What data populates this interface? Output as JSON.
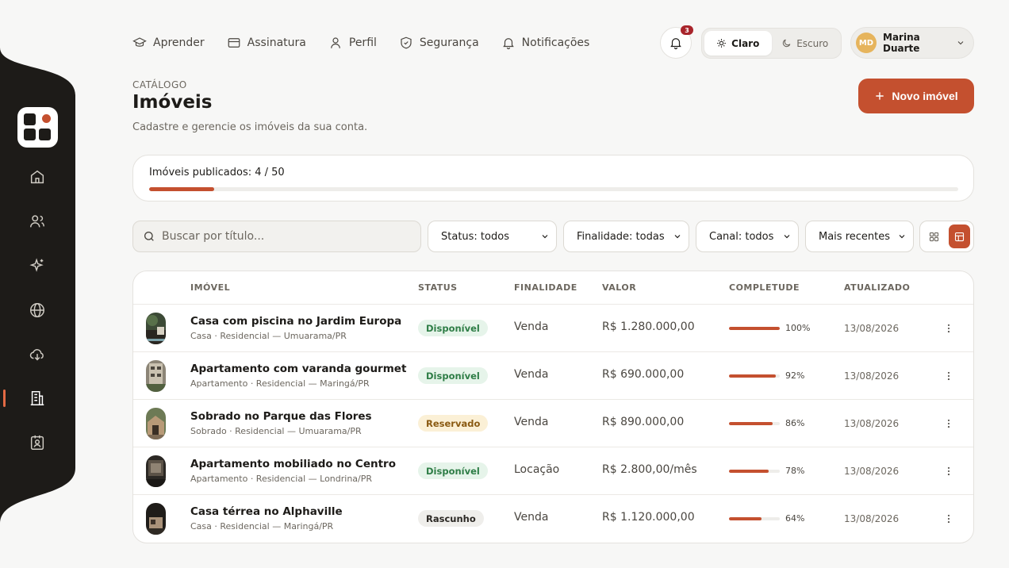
{
  "nav": [
    {
      "label": "Aprender",
      "icon": "graduation-cap-icon"
    },
    {
      "label": "Assinatura",
      "icon": "credit-card-icon"
    },
    {
      "label": "Perfil",
      "icon": "user-icon"
    },
    {
      "label": "Segurança",
      "icon": "shield-icon"
    },
    {
      "label": "Notificações",
      "icon": "bell-icon"
    }
  ],
  "notifications": {
    "count": "3"
  },
  "theme": {
    "light": "Claro",
    "dark": "Escuro",
    "selected": "Claro"
  },
  "user": {
    "initials": "MD",
    "name": "Marina Duarte"
  },
  "header": {
    "eyebrow": "CATÁLOGO",
    "title": "Imóveis",
    "subtitle": "Cadastre e gerencie os imóveis da sua conta.",
    "new_button": "Novo imóvel"
  },
  "quota": {
    "label": "Imóveis publicados: 4 / 50",
    "used": 4,
    "total": 50
  },
  "filters": {
    "search_placeholder": "Buscar por título...",
    "status": "Status: todos",
    "finalidade": "Finalidade: todas",
    "canal": "Canal: todos",
    "sort": "Mais recentes"
  },
  "table": {
    "headers": [
      "IMÓVEL",
      "STATUS",
      "FINALIDADE",
      "VALOR",
      "COMPLETUDE",
      "ATUALIZADO"
    ],
    "rows": [
      {
        "title": "Casa com piscina no Jardim Europa",
        "subtitle": "Casa · Residencial — Umuarama/PR",
        "status": "Disponível",
        "finalidade": "Venda",
        "valor": "R$ 1.280.000,00",
        "completude": 100,
        "completude_label": "100%",
        "atualizado": "13/08/2026"
      },
      {
        "title": "Apartamento com varanda gourmet",
        "subtitle": "Apartamento · Residencial — Maringá/PR",
        "status": "Disponível",
        "finalidade": "Venda",
        "valor": "R$ 690.000,00",
        "completude": 92,
        "completude_label": "92%",
        "atualizado": "13/08/2026"
      },
      {
        "title": "Sobrado no Parque das Flores",
        "subtitle": "Sobrado · Residencial — Umuarama/PR",
        "status": "Reservado",
        "finalidade": "Venda",
        "valor": "R$ 890.000,00",
        "completude": 86,
        "completude_label": "86%",
        "atualizado": "13/08/2026"
      },
      {
        "title": "Apartamento mobiliado no Centro",
        "subtitle": "Apartamento · Residencial — Londrina/PR",
        "status": "Disponível",
        "finalidade": "Locação",
        "valor": "R$ 2.800,00/mês",
        "completude": 78,
        "completude_label": "78%",
        "atualizado": "13/08/2026"
      },
      {
        "title": "Casa térrea no Alphaville",
        "subtitle": "Casa · Residencial — Maringá/PR",
        "status": "Rascunho",
        "finalidade": "Venda",
        "valor": "R$ 1.120.000,00",
        "completude": 64,
        "completude_label": "64%",
        "atualizado": "13/08/2026"
      }
    ]
  },
  "status_colors": {
    "Disponível": {
      "bg": "#e6f4ea",
      "fg": "#2e7d46"
    },
    "Reservado": {
      "bg": "#fbf0d6",
      "fg": "#8a5a12"
    },
    "Rascunho": {
      "bg": "#efeeeb",
      "fg": "#2b2824"
    }
  },
  "colors": {
    "accent": "#c4502f",
    "sidebar": "#1d1b18"
  }
}
